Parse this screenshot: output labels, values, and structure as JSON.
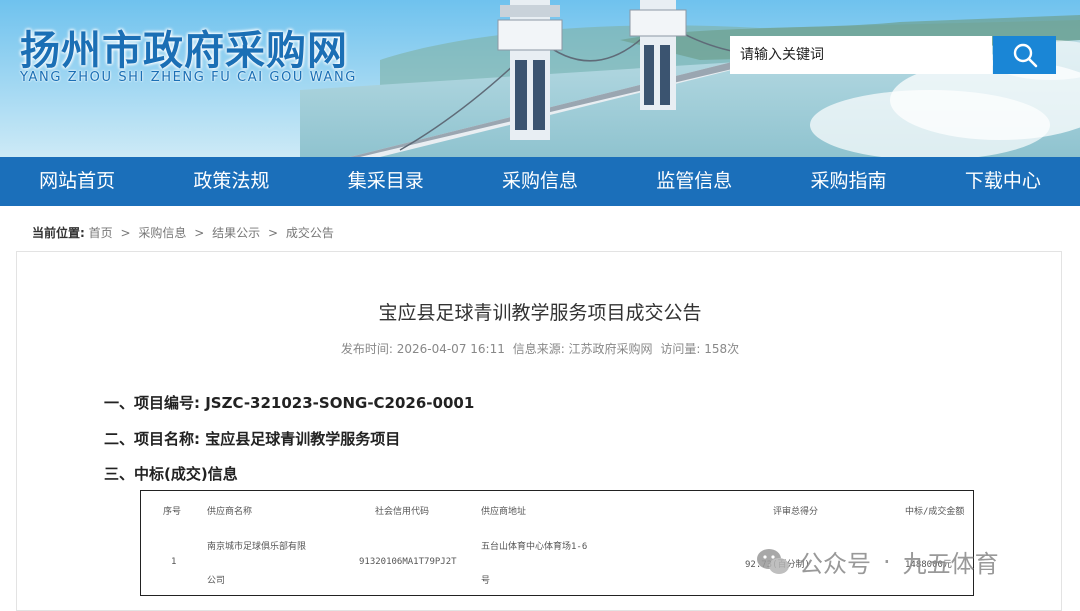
{
  "site": {
    "name_cn": "扬州市政府采购网",
    "name_en": "YANG ZHOU SHI ZHENG FU CAI GOU WANG"
  },
  "search": {
    "placeholder": "请输入关键词"
  },
  "nav": [
    {
      "label": "网站首页"
    },
    {
      "label": "政策法规"
    },
    {
      "label": "集采目录"
    },
    {
      "label": "采购信息"
    },
    {
      "label": "监管信息"
    },
    {
      "label": "采购指南"
    },
    {
      "label": "下载中心"
    }
  ],
  "breadcrumb": {
    "label": "当前位置:",
    "items": [
      "首页",
      "采购信息",
      "结果公示",
      "成交公告"
    ],
    "separator": ">"
  },
  "article": {
    "title": "宝应县足球青训教学服务项目成交公告",
    "publish_time": "发布时间: 2026-04-07 16:11",
    "source": "信息来源: 江苏政府采购网",
    "views": "访问量: 158次",
    "item1": "一、项目编号: JSZC-321023-SONG-C2026-0001",
    "item2": "二、项目名称: 宝应县足球青训教学服务项目",
    "item3": "三、中标(成交)信息"
  },
  "table": {
    "headers": [
      "序号",
      "供应商名称",
      "社会信用代码",
      "供应商地址",
      "评审总得分",
      "中标/成交金额"
    ],
    "row": {
      "no": "1",
      "name_line1": "南京城市足球俱乐部有限",
      "name_line2": "公司",
      "credit": "91320106MA1T79PJ2T",
      "addr_line1": "五台山体育中心体育场1-6",
      "addr_line2": "号",
      "score": "92.73(百分制)",
      "amount": "1488000元"
    }
  },
  "watermark": {
    "prefix": "公众号",
    "dot": "·",
    "name": "九五体育"
  },
  "colors": {
    "brand_blue": "#1b6fba",
    "search_button": "#1a86d6"
  }
}
